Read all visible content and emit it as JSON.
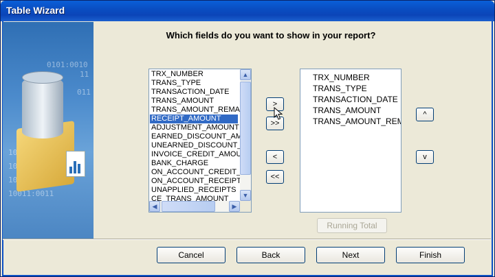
{
  "window": {
    "title": "Table Wizard"
  },
  "heading": "Which fields do you want to show in your report?",
  "available_fields": {
    "items": [
      "TRX_NUMBER",
      "TRANS_TYPE",
      "TRANSACTION_DATE",
      "TRANS_AMOUNT",
      "TRANS_AMOUNT_REMA",
      "RECEIPT_AMOUNT",
      "ADJUSTMENT_AMOUNT",
      "EARNED_DISCOUNT_AM",
      "UNEARNED_DISCOUNT_",
      "INVOICE_CREDIT_AMOU",
      "BANK_CHARGE",
      "ON_ACCOUNT_CREDIT_",
      "ON_ACCOUNT_RECEIPT",
      "UNAPPLIED_RECEIPTS",
      "CE_TRANS_AMOUNT"
    ],
    "selected": "RECEIPT_AMOUNT"
  },
  "selected_fields": {
    "items": [
      "TRX_NUMBER",
      "TRANS_TYPE",
      "TRANSACTION_DATE",
      "TRANS_AMOUNT",
      "TRANS_AMOUNT_REMA"
    ]
  },
  "move_buttons": {
    "add": ">",
    "add_all": ">>",
    "remove": "<",
    "remove_all": "<<"
  },
  "order_buttons": {
    "up": "^",
    "down": "v"
  },
  "running_total": "Running Total",
  "footer": {
    "cancel": "Cancel",
    "back": "Back",
    "next": "Next",
    "finish": "Finish"
  },
  "decoration": {
    "digits": [
      "0101:0010",
      "11",
      "011",
      "10101:0010",
      "101011101",
      "1010110011",
      "10011:0011"
    ]
  },
  "colors": {
    "title_bar": "#0a4ec2",
    "selection": "#316ac5",
    "panel": "#ece9d8"
  }
}
